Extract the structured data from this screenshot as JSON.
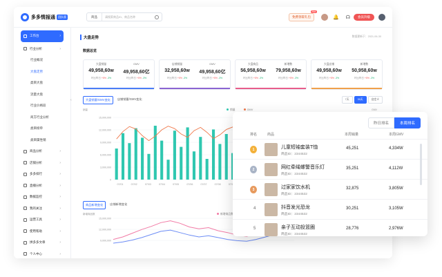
{
  "app": {
    "name": "多多情报通",
    "edition": "团队版"
  },
  "search": {
    "select": "商品",
    "placeholder": "请搜索商品ID、商品名称"
  },
  "promo": {
    "label": "免费领取礼包",
    "tag": "Hot"
  },
  "vip_label": "会员升级",
  "sidebar": {
    "items": [
      {
        "label": "工作台",
        "type": "active"
      },
      {
        "label": "行业分析",
        "type": "group"
      },
      {
        "label": "行业概况",
        "type": "sub"
      },
      {
        "label": "大盘走势",
        "type": "cur"
      },
      {
        "label": "类目大盘",
        "type": "sub"
      },
      {
        "label": "流量大盘",
        "type": "sub"
      },
      {
        "label": "行业价格段",
        "type": "sub"
      },
      {
        "label": "商方行业分析",
        "type": "sub"
      },
      {
        "label": "类目榜单",
        "type": "sub"
      },
      {
        "label": "类目属性销",
        "type": "sub"
      },
      {
        "label": "商品分析",
        "type": "group"
      },
      {
        "label": "店铺分析",
        "type": "group"
      },
      {
        "label": "多多排行",
        "type": "group"
      },
      {
        "label": "直播分析",
        "type": "group"
      },
      {
        "label": "数据监控",
        "type": "group"
      },
      {
        "label": "我的关注",
        "type": "group"
      },
      {
        "label": "运营工具",
        "type": "group"
      },
      {
        "label": "使用帮助",
        "type": "group"
      },
      {
        "label": "拼多多文章",
        "type": "group"
      },
      {
        "label": "个人中心",
        "type": "group"
      }
    ]
  },
  "panel": {
    "title": "大盘走势",
    "time": "数据更新于：2021-06-30",
    "section": "数据总览"
  },
  "cards": [
    {
      "l1": "大盘销量",
      "v1": "49,958,60w",
      "l2": "GMV",
      "v2": "49,958,60亿",
      "cmp": "环比昨日",
      "up": "+5%",
      "down": "-3%",
      "color": "#4a7cf6"
    },
    {
      "l1": "店铺销量",
      "v1": "32,958,60w",
      "l2": "GMV",
      "v2": "49,958,60亿",
      "cmp": "环比昨日",
      "up": "+5%",
      "down": "-3%",
      "color": "#8a63d2"
    },
    {
      "l1": "大盘商品",
      "v1": "56,958,60w",
      "l2": "新增数",
      "v2": "79,958,60w",
      "cmp": "环比昨日",
      "up": "+5%",
      "down": "-3%",
      "color": "#e85d8a"
    },
    {
      "l1": "大盘店铺",
      "v1": "49,958,60w",
      "l2": "新增数",
      "v2": "50,958,60w",
      "cmp": "环比昨日",
      "up": "+5%",
      "down": "-3%",
      "color": "#f0a04b"
    }
  ],
  "tabs1": [
    "大盘销量/GMV变化",
    "店铺销量/GMV变化"
  ],
  "range": [
    "7天",
    "30天",
    "自定义"
  ],
  "legend1": {
    "a": "销量",
    "b": "GMV"
  },
  "axis1": {
    "left_title": "销量",
    "right_title": "GMV"
  },
  "tabs2": [
    "商品新增变化",
    "店铺新增变化"
  ],
  "legend2": {
    "a": "新增商品数"
  },
  "axis2": {
    "left_title": "新增商品数"
  },
  "chart_data": [
    {
      "type": "bar",
      "title": "",
      "ylabel": "销量",
      "y2label": "GMV",
      "yticks": [
        "15,000,000",
        "12,000,000",
        "9,000,000",
        "6,000,000",
        "3,000,000",
        "0"
      ],
      "xticks": [
        "07/01",
        "07/02",
        "07/03",
        "07/04",
        "07/05",
        "07/06",
        "07/07",
        "07/08",
        "07/09",
        "07/10",
        "07/11",
        "07/12",
        "07/13"
      ],
      "ylim": [
        0,
        15000000
      ],
      "series": [
        {
          "name": "销量",
          "kind": "bar",
          "color": "#2fc7b0",
          "values": [
            7.5,
            11.2,
            8.8,
            12.4,
            10.1,
            6.2,
            13.0,
            9.4,
            4.8,
            11.8,
            7.9,
            12.6,
            6.8,
            10.3,
            5.0,
            12.1,
            8.6,
            11.0,
            6.4,
            7.2,
            10.8,
            9.1,
            12.2,
            5.6,
            8.0,
            11.5,
            6.0,
            9.6
          ]
        },
        {
          "name": "GMV",
          "kind": "line",
          "color": "#f0784a",
          "values": [
            9.8,
            11.6,
            12.8,
            12.2,
            10.6,
            9.4,
            10.5,
            12.0,
            12.9,
            12.3,
            11.0,
            10.2,
            11.8,
            12.6,
            11.4,
            9.9,
            10.8,
            12.1,
            12.7,
            11.9,
            10.4,
            11.2,
            12.5,
            12.0,
            10.6,
            11.3,
            12.4,
            11.7
          ]
        }
      ]
    },
    {
      "type": "line",
      "title": "",
      "ylabel": "新增商品数",
      "yticks": [
        "15,000,000",
        "12,000,000",
        "9,000,000"
      ],
      "series": [
        {
          "name": "新增商品数",
          "color": "#f27aa5",
          "values": [
            5.2,
            6.0,
            7.2,
            8.4,
            9.4,
            10.6,
            11.2,
            10.4,
            9.2,
            8.6,
            9.0,
            8.0,
            7.4,
            6.6,
            6.2,
            7.0,
            8.2,
            9.6,
            10.4,
            11.0
          ]
        },
        {
          "name": "",
          "color": "#6c8cf5",
          "values": [
            4.0,
            4.4,
            5.0,
            5.8,
            6.8,
            7.8,
            8.2,
            7.4,
            6.6,
            6.0,
            6.4,
            5.8,
            5.2,
            4.8,
            4.6,
            5.2,
            6.0,
            6.8,
            7.2,
            7.6
          ]
        }
      ]
    }
  ],
  "ranking": {
    "tabs": [
      "昨日排名",
      "本周排名"
    ],
    "headers": {
      "rank": "排名",
      "product": "商品",
      "sales": "本周销量",
      "gmv": "本周GMV"
    },
    "rows": [
      {
        "rank": "1",
        "name": "儿童短袖套装T恤",
        "pid": "商品ID：2344532",
        "sales": "45,251",
        "gmv": "4,334W",
        "medal": "#f3b13a"
      },
      {
        "rank": "2",
        "name": "网红牵绳螺警音乐灯",
        "pid": "商品ID：2344532",
        "sales": "35,251",
        "gmv": "4,112W",
        "medal": "#a9b4c6"
      },
      {
        "rank": "3",
        "name": "过家家饮水机",
        "pid": "商品ID：2344532",
        "sales": "32,875",
        "gmv": "3,805W",
        "medal": "#e79a5e"
      },
      {
        "rank": "4",
        "name": "抖音发光恐龙",
        "pid": "商品ID：2344532",
        "sales": "30,251",
        "gmv": "3,105W",
        "medal": ""
      },
      {
        "rank": "5",
        "name": "亲子互动投篮圈",
        "pid": "商品ID：2344532",
        "sales": "28,776",
        "gmv": "2,976W",
        "medal": ""
      }
    ]
  }
}
